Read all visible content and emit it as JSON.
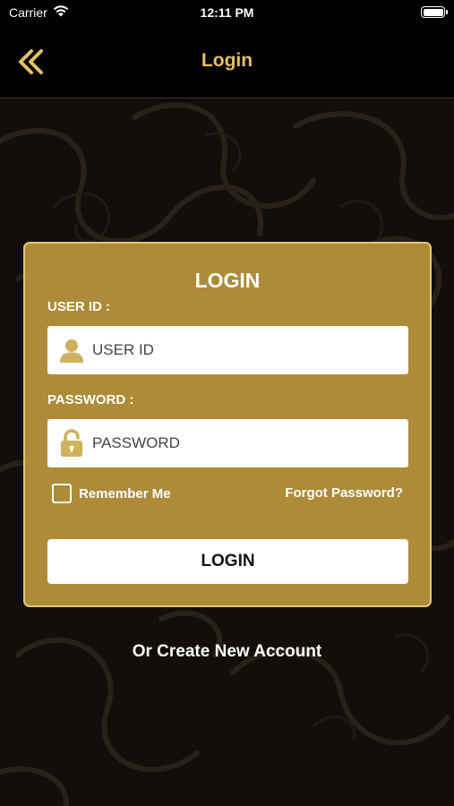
{
  "status_bar": {
    "carrier": "Carrier",
    "time": "12:11 PM"
  },
  "nav": {
    "title": "Login",
    "back_icon": "double-chevron-left-icon"
  },
  "card": {
    "title": "LOGIN",
    "user_id": {
      "label": "USER ID :",
      "placeholder": "USER ID",
      "value": "",
      "icon": "user-icon"
    },
    "password": {
      "label": "PASSWORD :",
      "placeholder": "PASSWORD",
      "value": "",
      "icon": "unlocked-padlock-icon"
    },
    "remember_label": "Remember Me",
    "remember_checked": false,
    "forgot_label": "Forgot Password?",
    "login_button_label": "LOGIN"
  },
  "create_account_label": "Or Create New Account",
  "colors": {
    "accent_gold": "#e2c06a",
    "card_background": "#ad8b38",
    "card_border": "#e1c67b",
    "icon_gold": "#cfb15e",
    "background": "#120e0a"
  }
}
